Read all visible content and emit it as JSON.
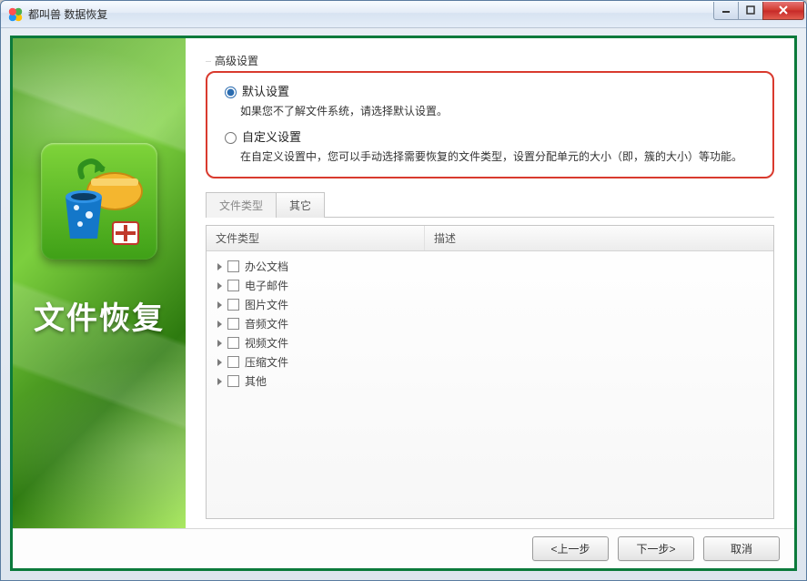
{
  "window": {
    "title": "都叫兽 数据恢复"
  },
  "sidebar": {
    "title": "文件恢复"
  },
  "settings": {
    "group_label": "高级设置",
    "options": [
      {
        "label": "默认设置",
        "description": "如果您不了解文件系统，请选择默认设置。",
        "selected": true
      },
      {
        "label": "自定义设置",
        "description": "在自定义设置中，您可以手动选择需要恢复的文件类型，设置分配单元的大小（即，簇的大小）等功能。",
        "selected": false
      }
    ]
  },
  "tabs": [
    {
      "label": "文件类型",
      "active": true
    },
    {
      "label": "其它",
      "active": false
    }
  ],
  "list": {
    "columns": {
      "type": "文件类型",
      "desc": "描述"
    },
    "items": [
      {
        "label": "办公文档"
      },
      {
        "label": "电子邮件"
      },
      {
        "label": "图片文件"
      },
      {
        "label": "音频文件"
      },
      {
        "label": "视频文件"
      },
      {
        "label": "压缩文件"
      },
      {
        "label": "其他"
      }
    ]
  },
  "footer": {
    "back": "<上一步",
    "next": "下一步>",
    "cancel": "取消"
  }
}
